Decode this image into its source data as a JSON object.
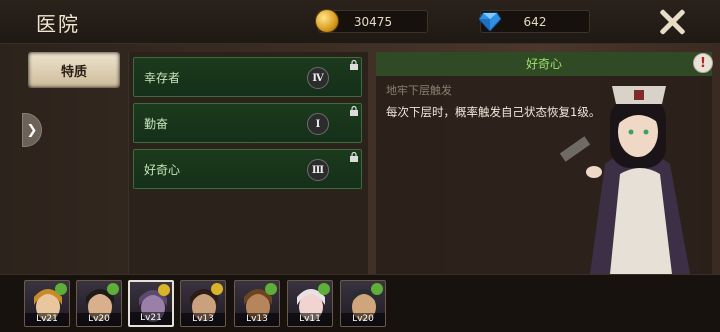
{
  "header": {
    "title": "医院"
  },
  "resources": {
    "gold": "30475",
    "gems": "642"
  },
  "tabs": {
    "trait": "特质"
  },
  "traits": [
    {
      "name": "幸存者",
      "rank": "Ⅳ"
    },
    {
      "name": "勤奋",
      "rank": "Ⅰ"
    },
    {
      "name": "好奇心",
      "rank": "Ⅲ"
    }
  ],
  "detail": {
    "title": "好奇心",
    "trigger": "地牢下层触发",
    "description": "每次下层时，概率触发自己状态恢复1级。"
  },
  "heroes": [
    {
      "level": "Lv21",
      "mood_color": "#5fae3a",
      "hair": "#c98a2a",
      "face": "#e9c69d"
    },
    {
      "level": "Lv20",
      "mood_color": "#5fae3a",
      "hair": "#1e1a1a",
      "face": "#d8b08b"
    },
    {
      "level": "Lv21",
      "mood_color": "#d9b42a",
      "hair": "#5a4a6e",
      "face": "#9a7fa8"
    },
    {
      "level": "Lv13",
      "mood_color": "#d9b42a",
      "hair": "#2b1d15",
      "face": "#caa07d"
    },
    {
      "level": "Lv13",
      "mood_color": "#5fae3a",
      "hair": "#6b4424",
      "face": "#b7855c"
    },
    {
      "level": "Lv11",
      "mood_color": "#5fae3a",
      "hair": "#e8e1e6",
      "face": "#f1d3d0"
    },
    {
      "level": "Lv20",
      "mood_color": "#5fae3a",
      "hair": "#2a2b33",
      "face": "#cfa57b"
    }
  ]
}
